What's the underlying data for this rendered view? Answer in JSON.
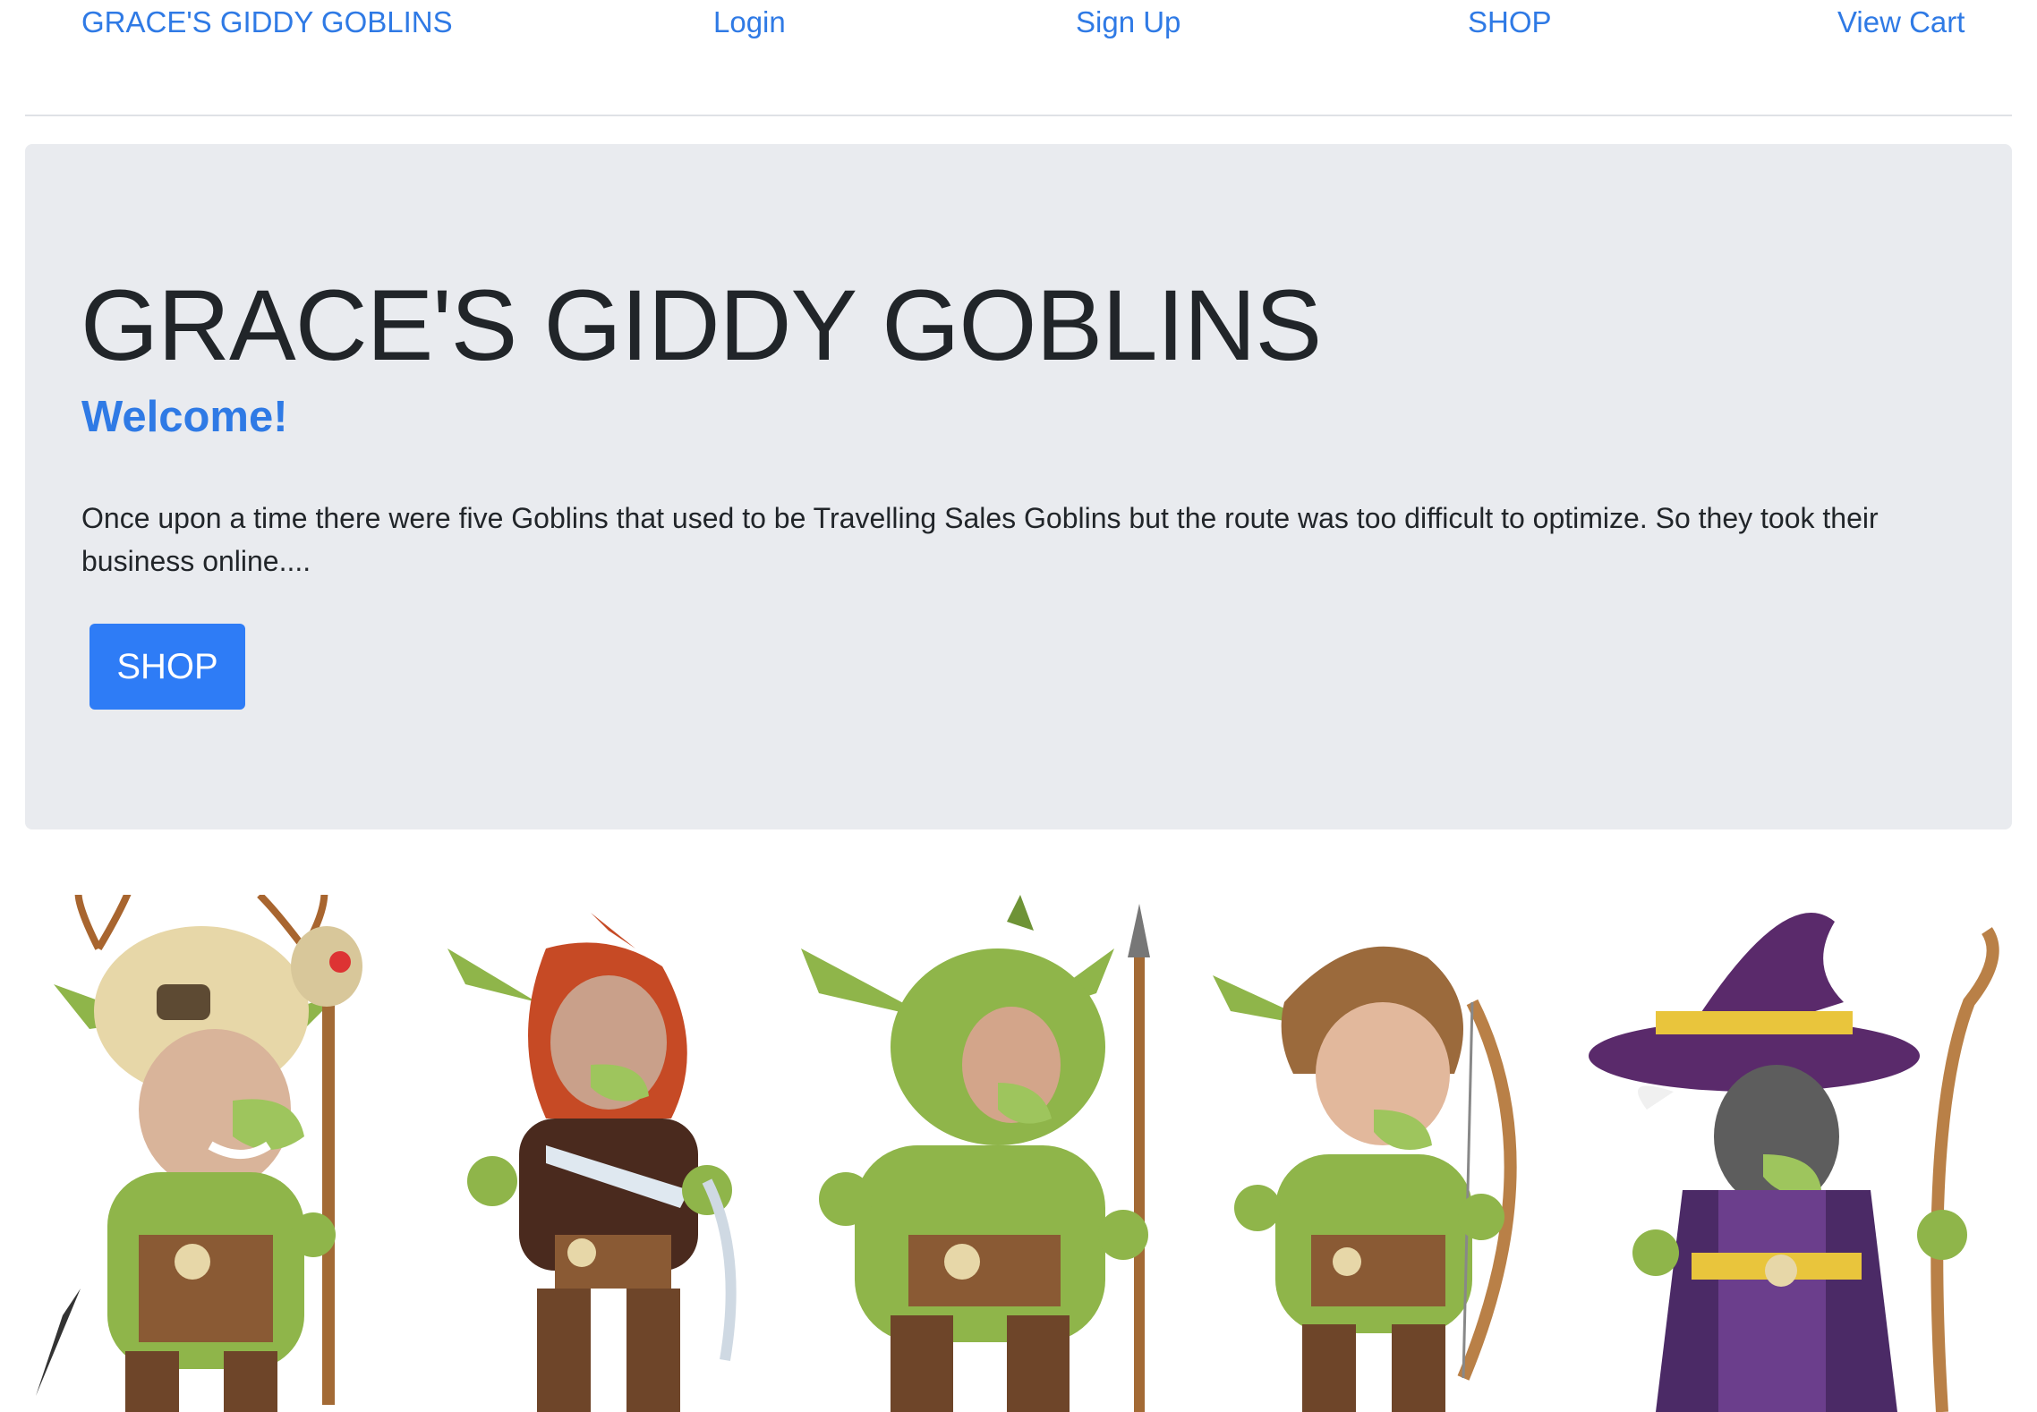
{
  "nav": {
    "brand": "GRACE'S GIDDY GOBLINS",
    "login": "Login",
    "signup": "Sign Up",
    "shop": "SHOP",
    "cart": "View Cart"
  },
  "hero": {
    "title": "GRACE'S GIDDY GOBLINS",
    "welcome": "Welcome!",
    "story": "Once upon a time there were five Goblins that used to be Travelling Sales Goblins but the route was too difficult to optimize. So they took their business online....",
    "shop_button": "SHOP"
  },
  "colors": {
    "link": "#2f7ae5",
    "button": "#2e7cf6",
    "jumbotron_bg": "#e9ebef",
    "goblin_skin": "#8fb54a",
    "goblin_skin_dark": "#6e9336",
    "leather": "#8a5a34",
    "wizard_purple": "#5a2a6b"
  },
  "goblins": [
    {
      "name": "skull-shaman-goblin",
      "headgear": "antler-skull",
      "weapon": "staff"
    },
    {
      "name": "hooded-rogue-goblin",
      "headgear": "red-hood",
      "weapon": "dagger"
    },
    {
      "name": "spear-warrior-goblin",
      "headgear": "none",
      "weapon": "spear"
    },
    {
      "name": "archer-goblin",
      "headgear": "leather-cap",
      "weapon": "bow"
    },
    {
      "name": "wizard-goblin",
      "headgear": "purple-hat",
      "weapon": "staff"
    }
  ]
}
